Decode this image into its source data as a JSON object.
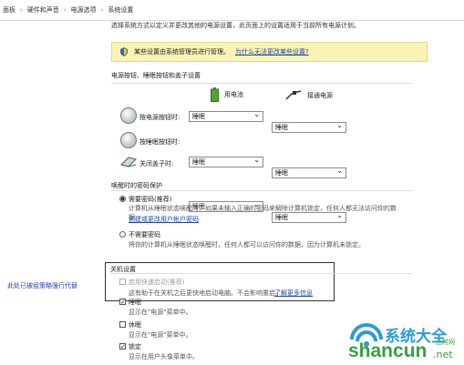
{
  "breadcrumb": [
    "面板",
    "硬件和声音",
    "电源选项",
    "系统设置"
  ],
  "cut_text": "选择系统方式以定义并更改其他的电源设置，此页面上的设置适用于当前所有电源计划。",
  "infobar": {
    "text": "某些设置由系统管理员进行管理。",
    "link": "为什么无法更改某些设置?"
  },
  "power_section": {
    "title": "电源按钮、睡眠按钮和盖子设置",
    "battery": "用电池",
    "plugged": "接通电源",
    "rows": [
      {
        "label": "按电源按钮时:",
        "battery": "睡眠",
        "plugged": "睡眠"
      },
      {
        "label": "按睡眠按钮时:",
        "battery": "睡眠",
        "plugged": "睡眠"
      },
      {
        "label": "关闭盖子时:",
        "battery": "睡眠",
        "plugged": "睡眠"
      }
    ]
  },
  "password_section": {
    "title": "唤醒时的密码保护",
    "opt1": "需要密码(推荐)",
    "opt1_desc1": "计算机从睡眠状态唤醒时，如果未输入正确的密码来解除计算机锁定，任何人都无法访问你的数据。",
    "opt1_link": "创建或更改用户帐户密码",
    "opt2": "不需要密码",
    "opt2_desc": "将你的计算机从睡眠状态唤醒时，任何人都可以访问你的数据，因为计算机未锁定。"
  },
  "shutdown_section": {
    "title": "关机设置",
    "fast_label": "启用快速启动(推荐)",
    "fast_desc": "这有助于在关机之后更快地启动电脑。不会影响重启。",
    "fast_link": "了解更多信息",
    "items": [
      {
        "label": "睡眠",
        "desc": "显示在\"电源\"菜单中。"
      },
      {
        "label": "休眠",
        "desc": "显示在\"电源\"菜单中。"
      },
      {
        "label": "锁定",
        "desc": "显示在用户头像菜单中。"
      }
    ]
  },
  "annotation": "此处已被组策略强行代替",
  "watermark": {
    "brand": "系统大全",
    "domain": "shancun",
    "tld": ".net",
    "sub": "山村网"
  }
}
